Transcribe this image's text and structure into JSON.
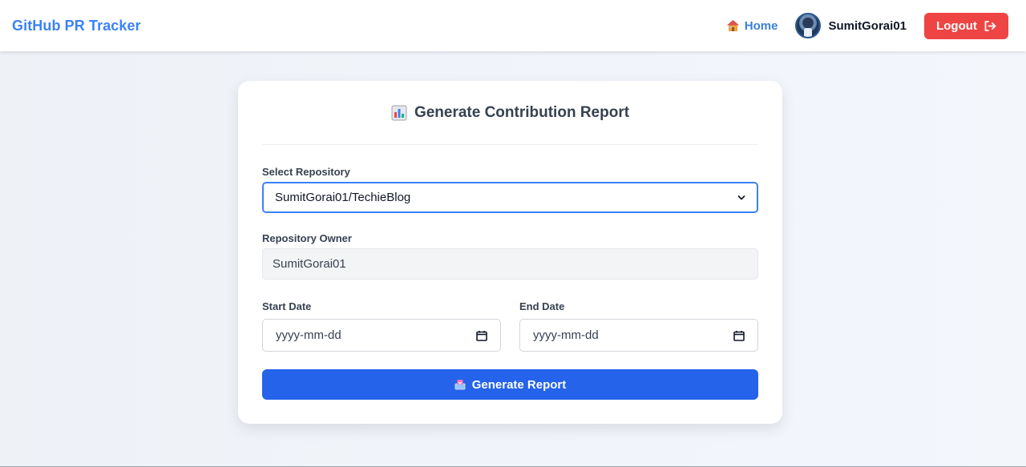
{
  "navbar": {
    "brand": "GitHub PR Tracker",
    "home_label": "Home",
    "home_icon": "house-emoji",
    "username": "SumitGorai01",
    "logout_label": "Logout",
    "logout_icon": "sign-out-icon"
  },
  "card": {
    "title": "Generate Contribution Report",
    "title_icon": "bar-chart-emoji",
    "repo_label": "Select Repository",
    "repo_selected": "SumitGorai01/TechieBlog",
    "owner_label": "Repository Owner",
    "owner_value": "SumitGorai01",
    "start_label": "Start Date",
    "start_placeholder": "yyyy-mm-dd",
    "end_label": "End Date",
    "end_placeholder": "yyyy-mm-dd",
    "generate_label": "Generate Report",
    "generate_icon": "inbox-tray-emoji"
  },
  "colors": {
    "brand": "#3b82f6",
    "logout": "#ef4444",
    "primary": "#2563eb",
    "select_border": "#3b82f6"
  }
}
